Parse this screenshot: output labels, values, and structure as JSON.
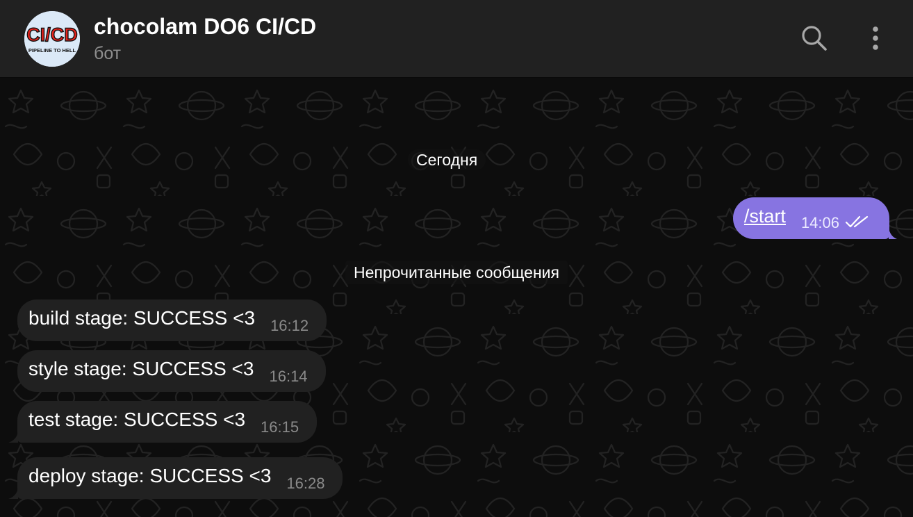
{
  "chat": {
    "title": "chocolam DO6 CI/CD",
    "subtitle": "бот",
    "avatar_text_top": "CI/CD",
    "avatar_text_bottom": "PIPELINE TO HELL"
  },
  "header_icons": [
    "search-icon",
    "more-vertical-icon"
  ],
  "date_separator": "Сегодня",
  "unread_label": "Непрочитанные сообщения",
  "outgoing": [
    {
      "text": "/start",
      "time": "14:06",
      "status": "read"
    }
  ],
  "incoming": [
    {
      "text": "build stage: SUCCESS <3",
      "time": "16:12"
    },
    {
      "text": "style stage: SUCCESS <3",
      "time": "16:14"
    },
    {
      "text": "test stage: SUCCESS <3",
      "time": "16:15"
    },
    {
      "text": "deploy stage: SUCCESS <3",
      "time": "16:28"
    }
  ],
  "colors": {
    "header_bg": "#212121",
    "chat_bg": "#0d0d0d",
    "outgoing_bubble": "#8774e1",
    "incoming_bubble": "#212121",
    "avatar_red": "#e8231c"
  }
}
